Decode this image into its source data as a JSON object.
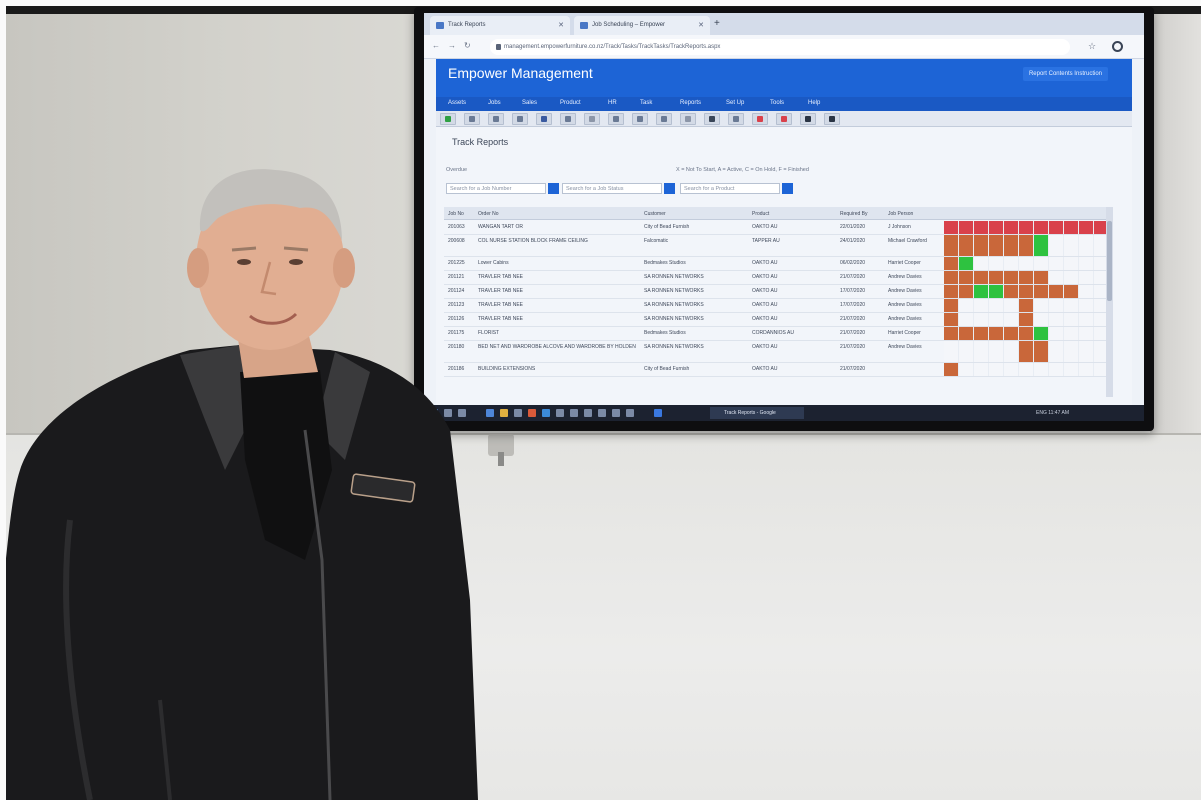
{
  "browser": {
    "tabs": [
      {
        "label": "Track Reports"
      },
      {
        "label": "Job Scheduling – Empower"
      }
    ],
    "url": "management.empowerfurniture.co.nz/Track/Tasks/TrackTasks/TrackReports.aspx"
  },
  "app": {
    "title": "Empower Management",
    "user_button": "Report Contents Instruction",
    "menu": [
      "Assets",
      "Jobs",
      "Sales",
      "Product",
      "HR",
      "Task",
      "Reports",
      "Set Up",
      "Tools",
      "Help"
    ],
    "toolbar_icons": [
      "check-icon",
      "refresh-icon",
      "sync-icon",
      "list-icon",
      "edit-icon",
      "copy-icon",
      "document-icon",
      "print-icon",
      "grid-icon",
      "calendar-icon",
      "clipboard-icon",
      "attach-icon",
      "file-icon",
      "close-icon",
      "delete-icon",
      "lock-icon",
      "car-icon"
    ]
  },
  "page": {
    "title": "Track Reports",
    "sub_heading": "Overdue",
    "legend": "X = Not To Start, A = Active, C = On Hold, F = Finished",
    "search": {
      "job_number_placeholder": "Search for a Job Number",
      "job_status_placeholder": "Search for a Job Status",
      "product_placeholder": "Search for a Product"
    },
    "columns": [
      "Job No",
      "Order No",
      "Customer",
      "Product",
      "Required By",
      "Job Person"
    ],
    "rows": [
      {
        "job_no": "201063",
        "order_no": "WANGAN TART OR",
        "customer": "City of Bead Furnish",
        "product": "OAKTO AU",
        "required_by": "22/01/2020",
        "person": "J Johnson",
        "status": [
          "red",
          "red",
          "red",
          "red",
          "red",
          "red",
          "red",
          "red",
          "red",
          "red",
          "red"
        ]
      },
      {
        "job_no": "200608",
        "order_no": "COL NURSE STATION BLOCK FRAME CEILING",
        "customer": "Falcomatic",
        "product": "TAPPER AU",
        "required_by": "24/01/2020",
        "person": "Michael Crawford",
        "status": [
          "orange",
          "orange",
          "orange",
          "orange",
          "orange",
          "orange",
          "green",
          "blank",
          "blank",
          "blank",
          "blank"
        ]
      },
      {
        "job_no": "201225",
        "order_no": "Lower Cabins",
        "customer": "Bedmakes Studios",
        "product": "OAKTO AU",
        "required_by": "06/02/2020",
        "person": "Harriet Cooper",
        "status": [
          "orange",
          "green",
          "blank",
          "blank",
          "blank",
          "blank",
          "blank",
          "blank",
          "blank",
          "blank",
          "blank"
        ]
      },
      {
        "job_no": "201121",
        "order_no": "TRAVLER TAB NEE",
        "customer": "SA RONNEN NETWORKS",
        "product": "OAKTO AU",
        "required_by": "21/07/2020",
        "person": "Andrew Davies",
        "status": [
          "orange",
          "orange",
          "orange",
          "orange",
          "orange",
          "orange",
          "orange",
          "blank",
          "blank",
          "blank",
          "blank"
        ]
      },
      {
        "job_no": "201124",
        "order_no": "TRAVLER TAB NEE",
        "customer": "SA RONNEN NETWORKS",
        "product": "OAKTO AU",
        "required_by": "17/07/2020",
        "person": "Andrew Davies",
        "status": [
          "orange",
          "orange",
          "green",
          "green",
          "orange",
          "orange",
          "orange",
          "orange",
          "orange",
          "blank",
          "blank"
        ]
      },
      {
        "job_no": "201123",
        "order_no": "TRAVLER TAB NEE",
        "customer": "SA RONNEN NETWORKS",
        "product": "OAKTO AU",
        "required_by": "17/07/2020",
        "person": "Andrew Davies",
        "status": [
          "orange",
          "blank",
          "blank",
          "blank",
          "blank",
          "orange",
          "blank",
          "blank",
          "blank",
          "blank",
          "blank"
        ]
      },
      {
        "job_no": "201126",
        "order_no": "TRAVLER TAB NEE",
        "customer": "SA RONNEN NETWORKS",
        "product": "OAKTO AU",
        "required_by": "21/07/2020",
        "person": "Andrew Davies",
        "status": [
          "orange",
          "blank",
          "blank",
          "blank",
          "blank",
          "orange",
          "blank",
          "blank",
          "blank",
          "blank",
          "blank"
        ]
      },
      {
        "job_no": "201175",
        "order_no": "FLORIST",
        "customer": "Bedmakes Studios",
        "product": "CORDANNIOS AU",
        "required_by": "21/07/2020",
        "person": "Harriet Cooper",
        "status": [
          "orange",
          "orange",
          "orange",
          "orange",
          "orange",
          "orange",
          "green",
          "blank",
          "blank",
          "blank",
          "blank"
        ]
      },
      {
        "job_no": "201180",
        "order_no": "BED NET AND WARDROBE ALCOVE AND WARDROBE BY HOLDEN",
        "customer": "SA RONNEN NETWORKS",
        "product": "OAKTO AU",
        "required_by": "21/07/2020",
        "person": "Andrew Davies",
        "status": [
          "blank",
          "blank",
          "blank",
          "blank",
          "blank",
          "orange",
          "orange",
          "blank",
          "blank",
          "blank",
          "blank"
        ]
      },
      {
        "job_no": "201186",
        "order_no": "BUILDING EXTENSIONS",
        "customer": "City of Bead Furnish",
        "product": "OAKTO AU",
        "required_by": "21/07/2020",
        "person": "",
        "status": [
          "orange",
          "blank",
          "blank",
          "blank",
          "blank",
          "blank",
          "blank",
          "blank",
          "blank",
          "blank",
          "blank"
        ]
      }
    ]
  },
  "taskbar": {
    "active_app": "Track Reports - Google",
    "tray": "ENG  11:47 AM"
  },
  "colors": {
    "app_blue": "#1d64d6",
    "status_red": "#d9414b",
    "status_orange": "#c9673a",
    "status_green": "#2ec240"
  }
}
